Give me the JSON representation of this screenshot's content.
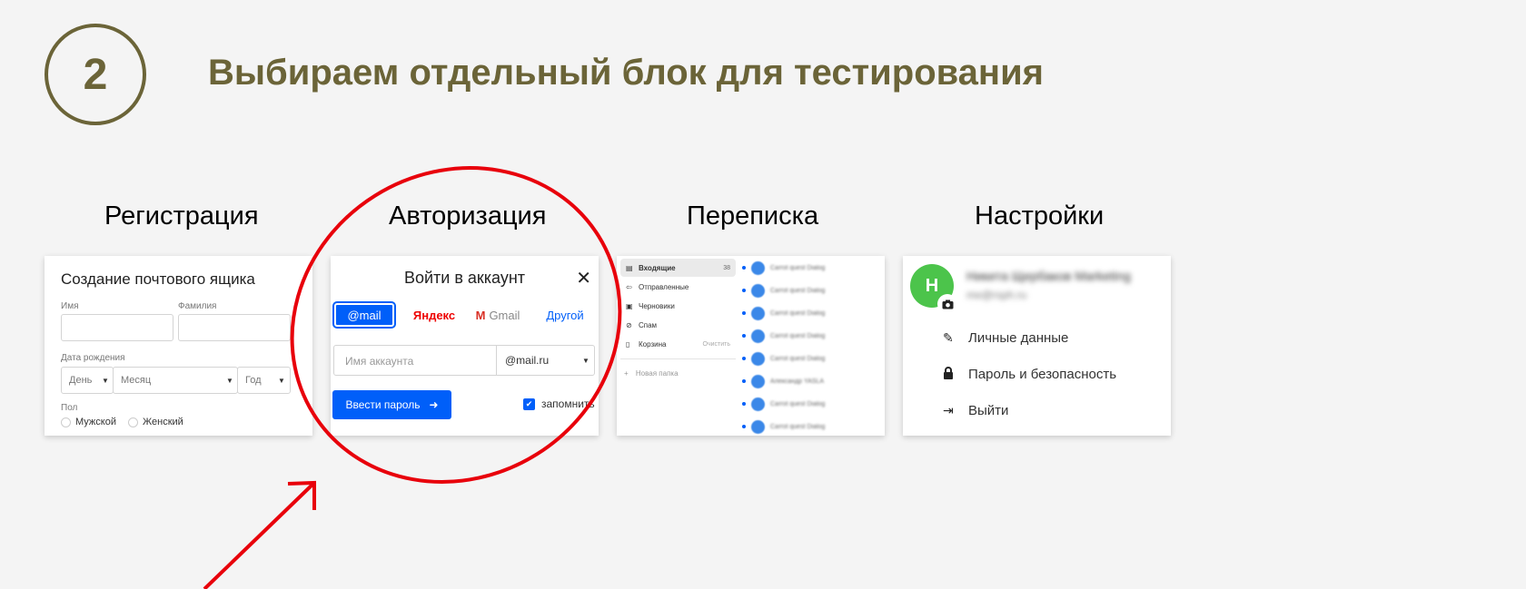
{
  "slide": {
    "step_number": "2",
    "title": "Выбираем отдельный блок для тестирования",
    "accent_color": "#6b6438",
    "highlight_color": "#e8000b"
  },
  "sections": {
    "registration": "Регистрация",
    "authorization": "Авторизация",
    "messaging": "Переписка",
    "settings": "Настройки"
  },
  "registration_card": {
    "title": "Создание почтового ящика",
    "first_name_label": "Имя",
    "last_name_label": "Фамилия",
    "birth_date_label": "Дата рождения",
    "day_placeholder": "День",
    "month_placeholder": "Месяц",
    "year_placeholder": "Год",
    "gender_label": "Пол",
    "gender_male": "Мужской",
    "gender_female": "Женский"
  },
  "auth_card": {
    "title": "Войти в аккаунт",
    "close": "✕",
    "providers": {
      "mail": "@mail",
      "yandex": "Яндекс",
      "gmail": "Gmail",
      "other": "Другой"
    },
    "account_placeholder": "Имя аккаунта",
    "domain": "@mail.ru",
    "submit": "Ввести пароль",
    "remember": "запомнить"
  },
  "mail_card": {
    "folders": [
      {
        "label": "Входящие",
        "icon": "inbox-icon",
        "count": "38"
      },
      {
        "label": "Отправленные",
        "icon": "sent-icon"
      },
      {
        "label": "Черновики",
        "icon": "drafts-icon"
      },
      {
        "label": "Спам",
        "icon": "spam-icon"
      },
      {
        "label": "Корзина",
        "icon": "trash-icon",
        "action": "Очистить"
      }
    ],
    "new_folder": "Новая папка",
    "messages": [
      "Carrot quest Dialog",
      "Carrot quest Dialog",
      "Carrot quest Dialog",
      "Carrot quest Dialog",
      "Carrot quest Dialog",
      "Александр YASLA",
      "Carrot quest Dialog",
      "Carrot quest Dialog"
    ]
  },
  "settings_card": {
    "avatar_letter": "Н",
    "items": [
      {
        "label": "Личные данные",
        "icon": "person-edit-icon"
      },
      {
        "label": "Пароль и безопасность",
        "icon": "lock-icon"
      },
      {
        "label": "Выйти",
        "icon": "logout-icon"
      }
    ]
  }
}
